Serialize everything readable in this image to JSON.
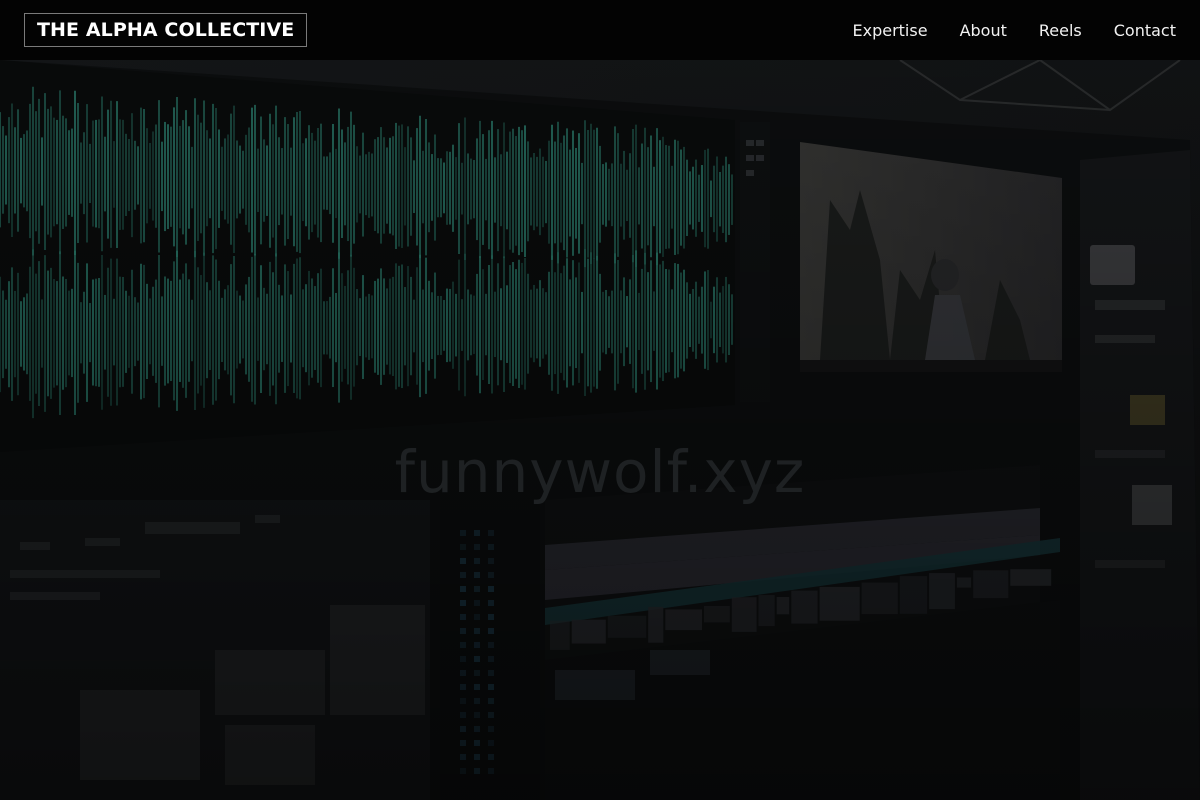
{
  "brand": {
    "name": "THE ALPHA COLLECTIVE"
  },
  "nav": {
    "items": [
      {
        "id": "expertise",
        "label": "Expertise"
      },
      {
        "id": "about",
        "label": "About"
      },
      {
        "id": "reels",
        "label": "Reels"
      },
      {
        "id": "contact",
        "label": "Contact"
      }
    ]
  },
  "hero": {
    "watermark": "funnywolf.xyz",
    "colors": {
      "waveform": "#2f8a78",
      "overlay": "#000000"
    }
  }
}
